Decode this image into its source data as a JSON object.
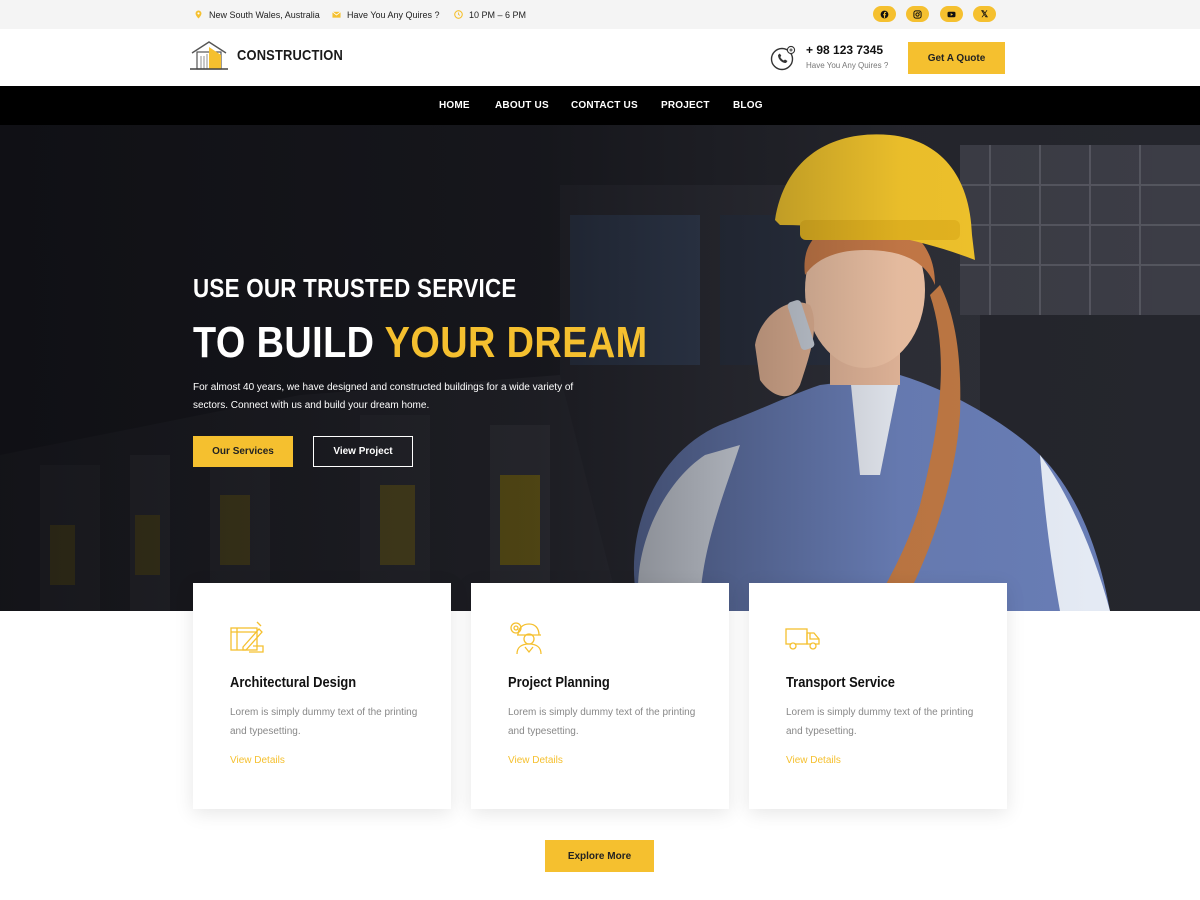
{
  "topbar": {
    "location": "New South Wales, Australia",
    "email_text": "Have You Any Quires ?",
    "hours": "10 PM – 6 PM",
    "socials": [
      "facebook-icon",
      "instagram-icon",
      "youtube-icon",
      "x-icon"
    ],
    "x_glyph": "𝕏"
  },
  "header": {
    "logo_text": "CONSTRUCTION",
    "phone": "+ 98 123 7345",
    "phone_sub": "Have You Any Quires ?",
    "quote_label": "Get A Quote"
  },
  "nav": {
    "items": [
      "HOME",
      "ABOUT US",
      "CONTACT US",
      "PROJECT",
      "BLOG"
    ]
  },
  "hero": {
    "subtitle": "USE OUR TRUSTED SERVICE",
    "title_main": "TO BUILD ",
    "title_accent": "YOUR DREAM",
    "description": "For almost 40 years, we have designed and constructed buildings for a wide variety of sectors. Connect with us and build your dream home.",
    "primary_button": "Our Services",
    "secondary_button": "View Project"
  },
  "cards": [
    {
      "icon": "drafting-icon",
      "title": "Architectural Design",
      "text": "Lorem is simply dummy text of the printing and typesetting.",
      "link": "View Details"
    },
    {
      "icon": "engineer-icon",
      "title": "Project Planning",
      "text": "Lorem is simply dummy text of the printing and typesetting.",
      "link": "View Details"
    },
    {
      "icon": "truck-icon",
      "title": "Transport Service",
      "text": "Lorem is simply dummy text of the printing and typesetting.",
      "link": "View Details"
    }
  ],
  "explore_label": "Explore More",
  "colors": {
    "accent": "#f5c02f",
    "nav_bg": "#000000",
    "topbar_bg": "#f4f4f4"
  }
}
